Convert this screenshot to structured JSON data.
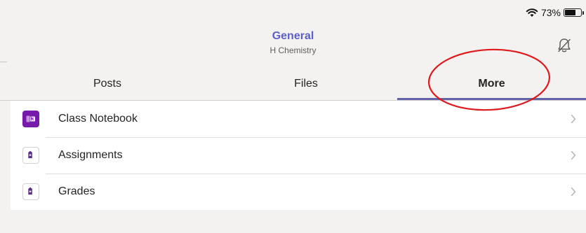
{
  "status_bar": {
    "battery_percent": "73%",
    "battery_level": 0.73
  },
  "header": {
    "channel_title": "General",
    "team_name": "H Chemistry"
  },
  "tabs": [
    {
      "label": "Posts",
      "active": false
    },
    {
      "label": "Files",
      "active": false
    },
    {
      "label": "More",
      "active": true
    }
  ],
  "more_items": [
    {
      "label": "Class Notebook",
      "icon": "onenote-class-notebook-icon"
    },
    {
      "label": "Assignments",
      "icon": "assignments-icon"
    },
    {
      "label": "Grades",
      "icon": "grades-icon"
    }
  ],
  "colors": {
    "accent": "#6264a7",
    "title": "#5b5fc7",
    "notebook": "#7719aa",
    "annotation": "#e0171b"
  }
}
